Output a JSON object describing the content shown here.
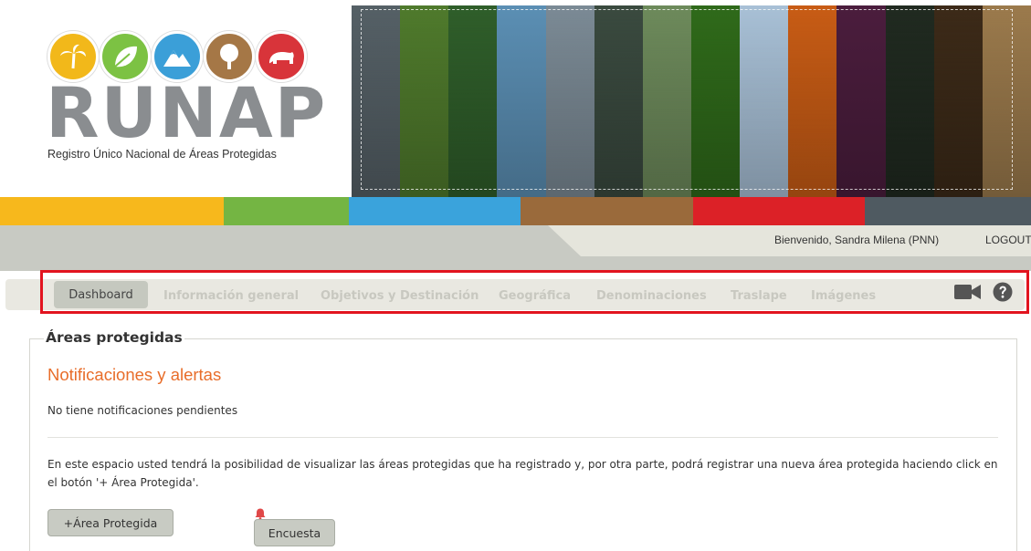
{
  "logo": {
    "word": "RUNAP",
    "subtitle": "Registro Único Nacional de Áreas Protegidas",
    "icons": [
      "palm-tree-icon",
      "leaf-icon",
      "mountain-icon",
      "tree-icon",
      "bear-icon"
    ],
    "icon_colors": [
      "#f2b81a",
      "#7cc243",
      "#3b9fd8",
      "#a57746",
      "#d8343a"
    ]
  },
  "banner": {
    "strip_colors": [
      "#556066",
      "#4f7a2c",
      "#2f5e2a",
      "#5b8fb4",
      "#7b8a95",
      "#3a4a3f",
      "#6d8a5b",
      "#2f6a1a",
      "#a8c0d6",
      "#c85c15",
      "#4b1d3d",
      "#202a20",
      "#3c2a18",
      "#9b7a4c"
    ]
  },
  "color_bar": [
    "#f7b81c",
    "#74b543",
    "#3aa3dc",
    "#9a6a3b",
    "#dc2127",
    "#4f5a61"
  ],
  "header": {
    "welcome": "Bienvenido, Sandra Milena (PNN)",
    "logout": "LOGOUT"
  },
  "nav": {
    "items": [
      "Dashboard",
      "Información general",
      "Objetivos y Destinación",
      "Geográfica",
      "Denominaciones",
      "Traslape",
      "Imágenes"
    ],
    "active": "Dashboard",
    "icons": [
      "video-camera-icon",
      "help-icon"
    ]
  },
  "main": {
    "legend": "Áreas protegidas",
    "section_title": "Notificaciones y alertas",
    "no_notifications": "No tiene notificaciones pendientes",
    "description": "En este espacio usted tendrá la posibilidad de visualizar las áreas protegidas que ha registrado y, por otra parte, podrá registrar una nueva área protegida haciendo click en el botón '+ Área Protegida'.",
    "add_area_button": "+Área Protegida",
    "survey_button": "Encuesta"
  }
}
